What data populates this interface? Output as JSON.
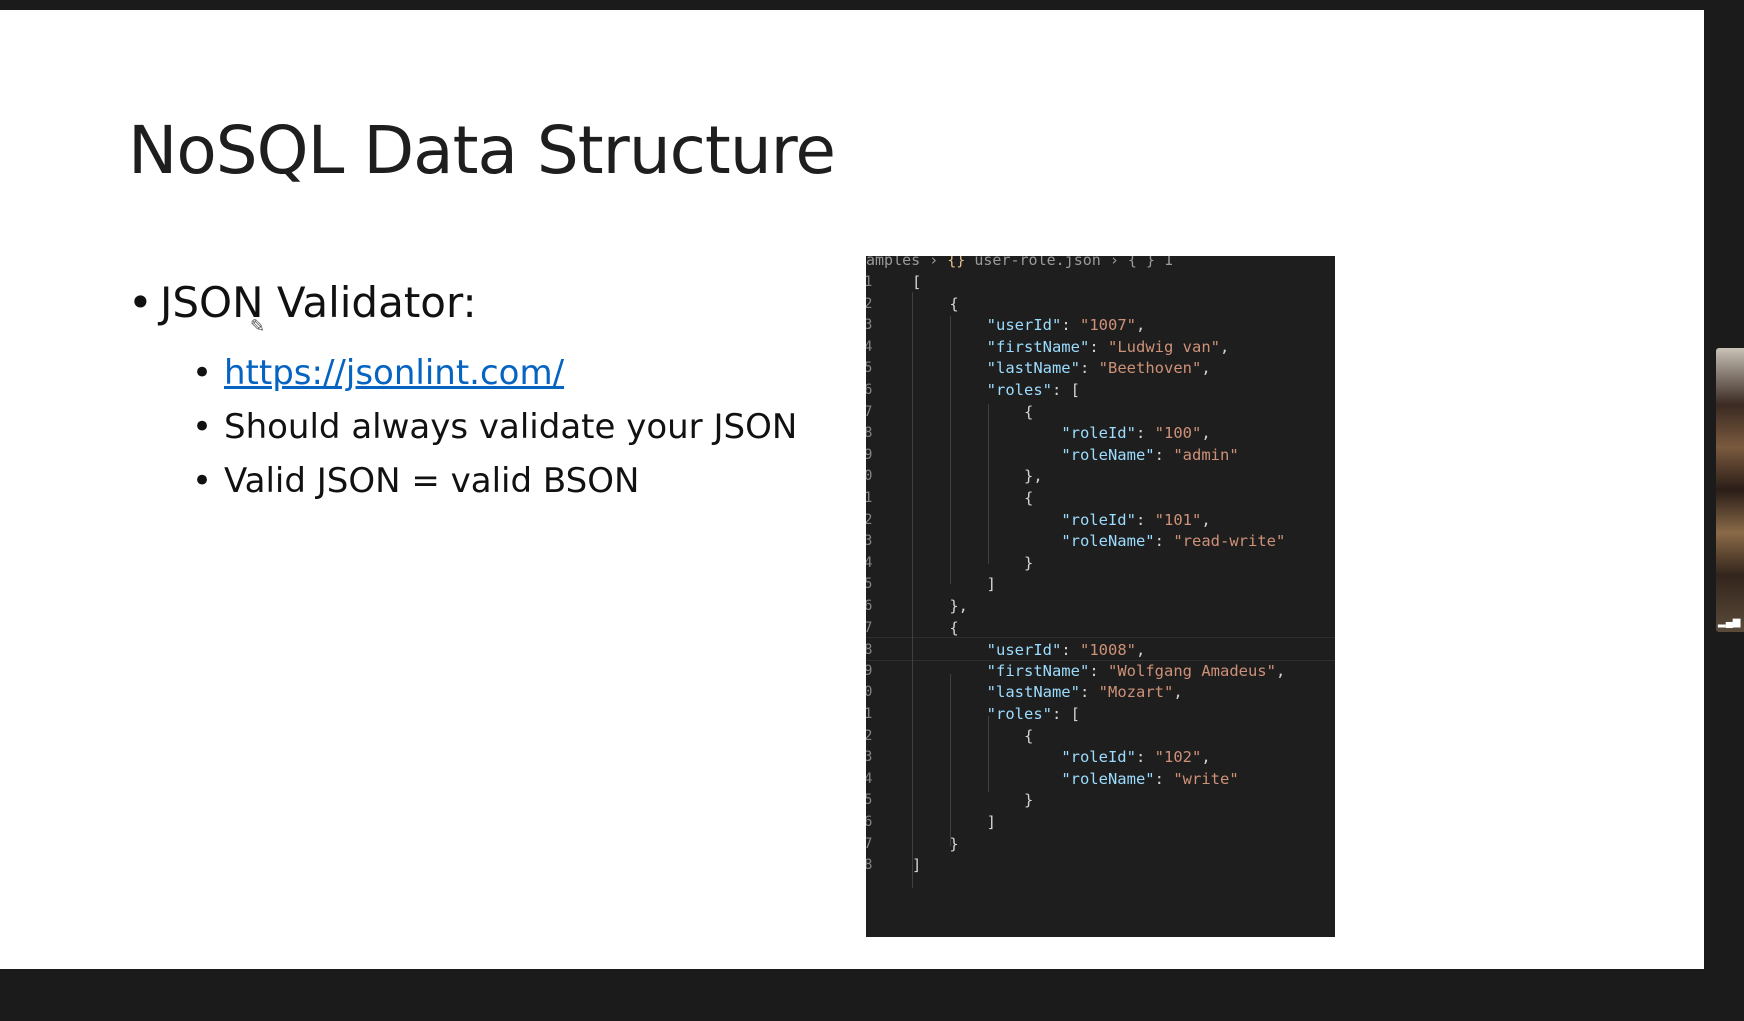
{
  "slide": {
    "title": "NoSQL Data Structure",
    "bullet": "JSON Validator:",
    "sub_items": [
      {
        "text": "https://jsonlint.com/",
        "is_link": true
      },
      {
        "text": "Should always validate your JSON",
        "is_link": false
      },
      {
        "text": "Valid JSON = valid BSON",
        "is_link": false
      }
    ]
  },
  "code_editor": {
    "breadcrumb": {
      "folder": "amples",
      "file": "user-role.json",
      "tail": "{ } 1"
    },
    "line_numbers": [
      "1",
      "2",
      "3",
      "4",
      "5",
      "6",
      "7",
      "8",
      "9",
      "0",
      "1",
      "2",
      "3",
      "4",
      "5",
      "6",
      "7",
      "8",
      "9",
      "0",
      "1",
      "2",
      "3",
      "4",
      "5",
      "6",
      "7",
      "8"
    ],
    "lines": [
      "[",
      "    {",
      "        \"userId\": \"1007\",",
      "        \"firstName\": \"Ludwig van\",",
      "        \"lastName\": \"Beethoven\",",
      "        \"roles\": [",
      "            {",
      "                \"roleId\": \"100\",",
      "                \"roleName\": \"admin\"",
      "            },",
      "            {",
      "                \"roleId\": \"101\",",
      "                \"roleName\": \"read-write\"",
      "            }",
      "        ]",
      "    },",
      "    {",
      "        \"userId\": \"1008\",",
      "        \"firstName\": \"Wolfgang Amadeus\",",
      "        \"lastName\": \"Mozart\",",
      "        \"roles\": [",
      "            {",
      "                \"roleId\": \"102\",",
      "                \"roleName\": \"write\"",
      "            }",
      "        ]",
      "    }",
      "]"
    ],
    "active_line": 17,
    "colors": {
      "background": "#1e1e1e",
      "key": "#9cdcfe",
      "string": "#ce9178",
      "punctuation": "#d4d4d4",
      "line_number": "#858585"
    }
  },
  "colors": {
    "link": "#0563c1",
    "slide_background": "#ffffff",
    "frame": "#1b1b1b"
  },
  "side_thumbnail": {
    "icon": "signal-bars-icon"
  }
}
